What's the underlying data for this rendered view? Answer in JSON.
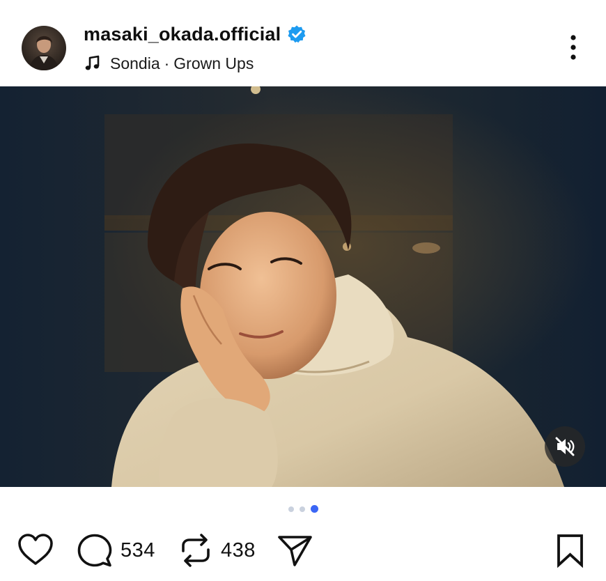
{
  "post": {
    "username": "masaki_okada.official",
    "verified": true,
    "music": {
      "artist": "Sondia",
      "separator": "·",
      "track": "Grown Ups"
    }
  },
  "media": {
    "carousel_total": 3,
    "carousel_active_index": 2,
    "muted": true
  },
  "actions": {
    "comments_count": "534",
    "reposts_count": "438"
  },
  "icons": {
    "like": "heart-icon",
    "comment": "comment-icon",
    "repost": "repost-icon",
    "share": "send-icon",
    "save": "bookmark-icon",
    "more": "more-vertical-icon",
    "mute": "speaker-muted-icon",
    "music": "music-note-icon",
    "verified": "verified-badge-icon"
  },
  "colors": {
    "verified_blue": "#1d9bf0",
    "carousel_active": "#3b66f5",
    "carousel_inactive": "#c9d1de",
    "text": "#111111"
  }
}
